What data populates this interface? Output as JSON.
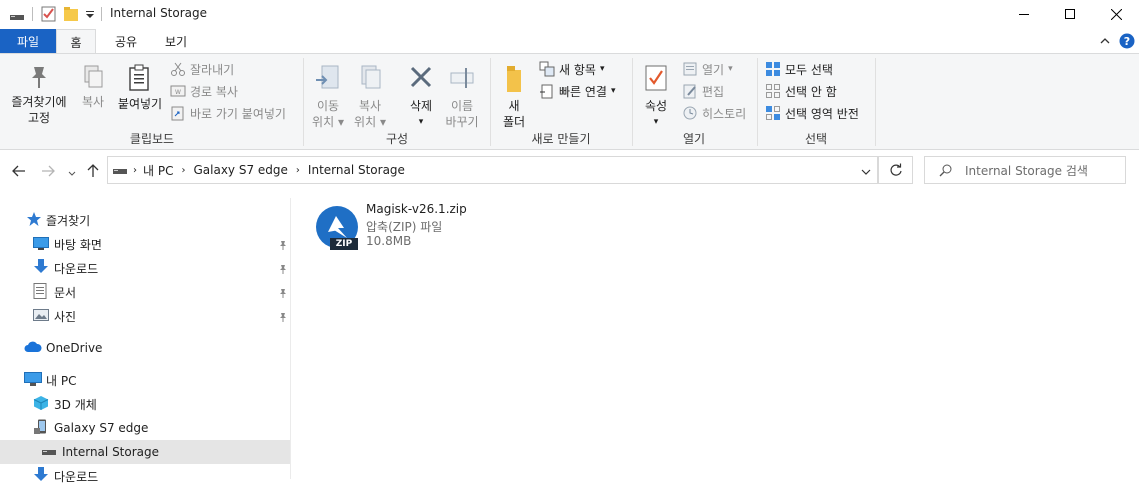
{
  "window": {
    "title": "Internal Storage",
    "minimize_glyph": "—",
    "maximize_glyph": "☐",
    "close_glyph": "✕"
  },
  "tabs": [
    {
      "label": "파일"
    },
    {
      "label": "홈"
    },
    {
      "label": "공유"
    },
    {
      "label": "보기"
    }
  ],
  "ribbon": {
    "clipboard": {
      "group_label": "클립보드",
      "pin_label_1": "즐겨찾기에",
      "pin_label_2": "고정",
      "copy_label": "복사",
      "paste_label": "붙여넣기",
      "cut_label": "잘라내기",
      "copy_path_label": "경로 복사",
      "paste_shortcut_label": "바로 가기 붙여넣기"
    },
    "organize": {
      "group_label": "구성",
      "move_label_1": "이동",
      "move_label_2": "위치",
      "copyto_label_1": "복사",
      "copyto_label_2": "위치",
      "delete_label": "삭제",
      "rename_label_1": "이름",
      "rename_label_2": "바꾸기"
    },
    "new": {
      "group_label": "새로 만들기",
      "new_folder_label_1": "새",
      "new_folder_label_2": "폴더",
      "new_item_label": "새 항목",
      "easy_access_label": "빠른 연결"
    },
    "open": {
      "group_label": "열기",
      "properties_label": "속성",
      "open_label": "열기",
      "edit_label": "편집",
      "history_label": "히스토리"
    },
    "select": {
      "group_label": "선택",
      "select_all_label": "모두 선택",
      "select_none_label": "선택 안 함",
      "invert_label": "선택 영역 반전"
    }
  },
  "address": {
    "crumbs": [
      "내 PC",
      "Galaxy S7 edge",
      "Internal Storage"
    ],
    "search_placeholder": "Internal Storage 검색"
  },
  "nav": {
    "quick_access": "즐겨찾기",
    "desktop": "바탕 화면",
    "downloads": "다운로드",
    "documents": "문서",
    "pictures": "사진",
    "onedrive": "OneDrive",
    "this_pc": "내 PC",
    "objects3d": "3D 개체",
    "device": "Galaxy S7 edge",
    "storage": "Internal Storage",
    "downloads2": "다운로드"
  },
  "files": [
    {
      "name": "Magisk-v26.1.zip",
      "type": "압축(ZIP) 파일",
      "size": "10.8MB",
      "badge": "ZIP"
    }
  ],
  "colors": {
    "accent": "#1a63c4",
    "selected_nav": "#e5e5e5",
    "magisk_blue": "#1f6fc5"
  }
}
